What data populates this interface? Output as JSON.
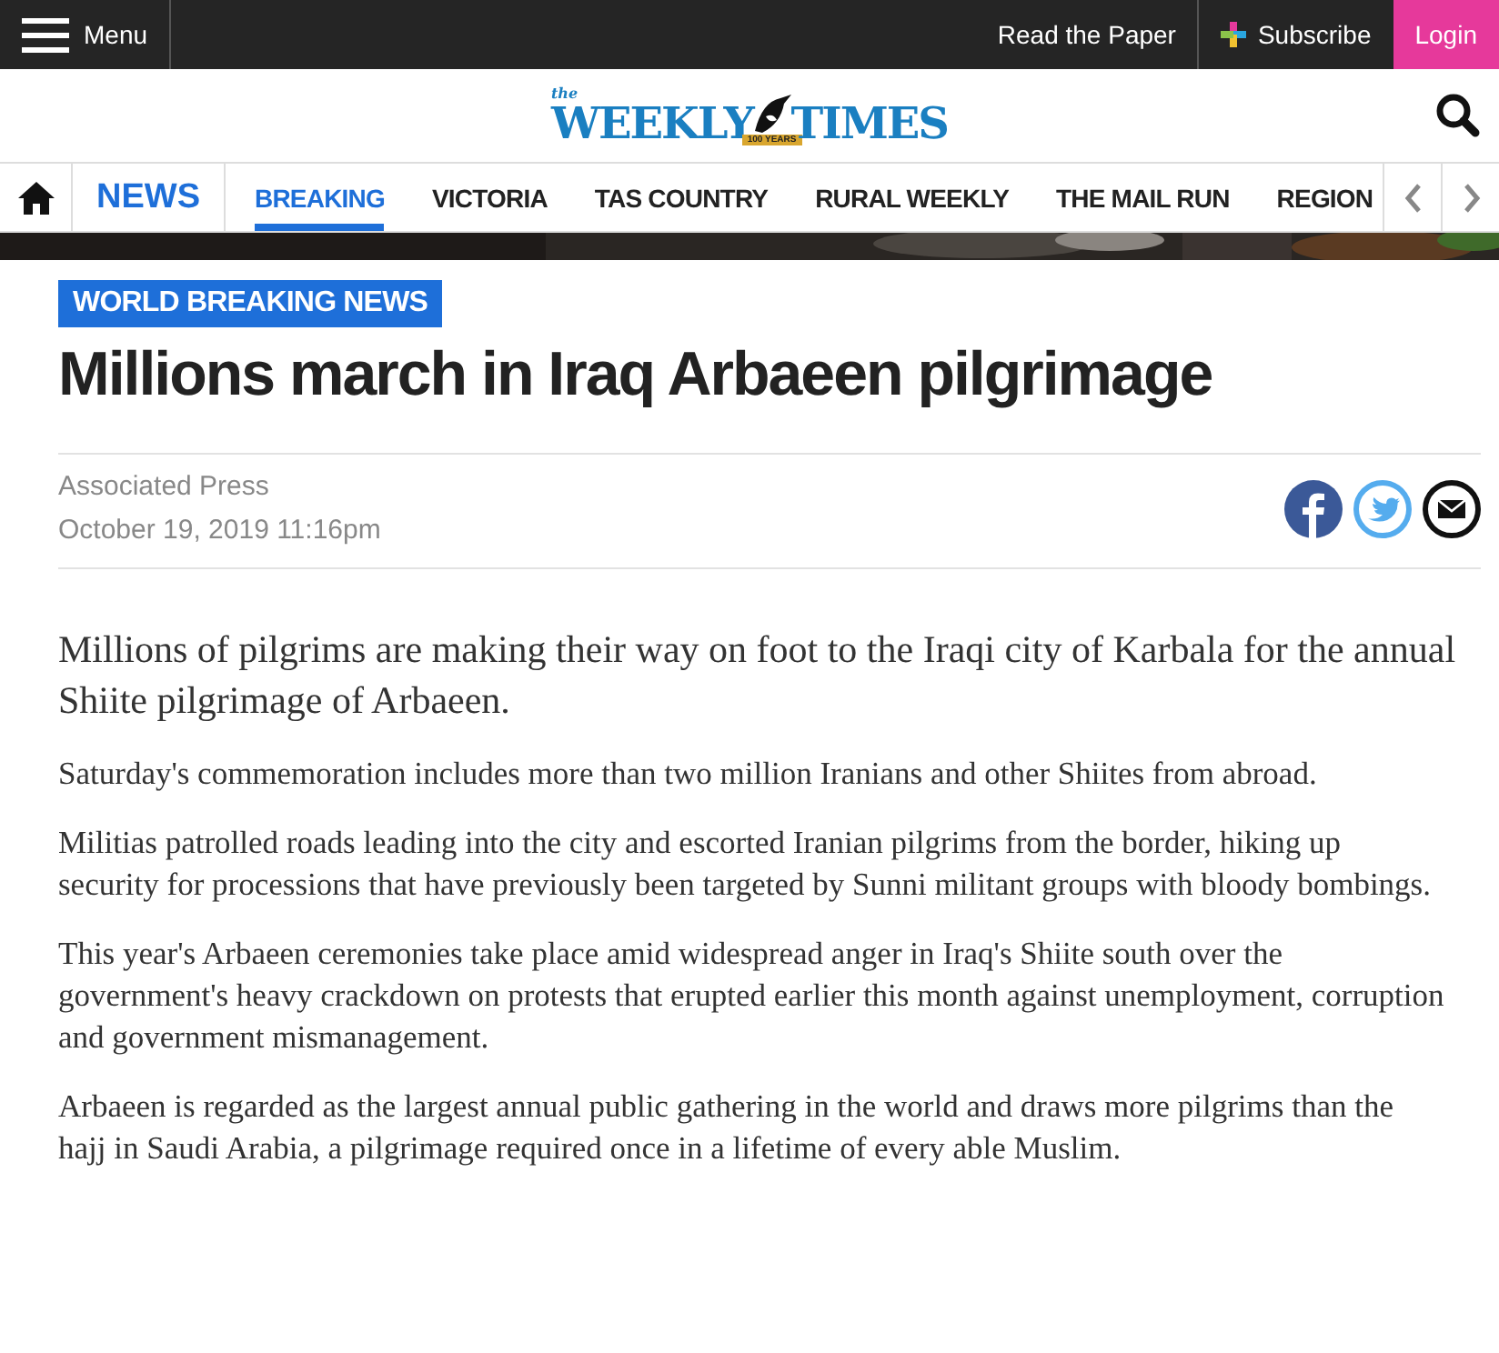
{
  "top_bar": {
    "menu": "Menu",
    "read_paper": "Read the Paper",
    "subscribe": "Subscribe",
    "login": "Login"
  },
  "logo": {
    "small": "the",
    "left": "WEEKLY",
    "right": "TIMES",
    "badge": "100 YEARS"
  },
  "nav": {
    "section": "NEWS",
    "items": [
      {
        "label": "BREAKING",
        "selected": true
      },
      {
        "label": "VICTORIA",
        "selected": false
      },
      {
        "label": "TAS COUNTRY",
        "selected": false
      },
      {
        "label": "RURAL WEEKLY",
        "selected": false
      },
      {
        "label": "THE MAIL RUN",
        "selected": false
      },
      {
        "label": "REGION",
        "selected": false
      }
    ]
  },
  "article": {
    "category": "WORLD BREAKING NEWS",
    "headline": "Millions march in Iraq Arbaeen pilgrimage",
    "author": "Associated Press",
    "date": "October 19, 2019 11:16pm",
    "lead": "Millions of pilgrims are making their way on foot to the Iraqi city of Karbala for the annual Shiite pilgrimage of Arbaeen.",
    "paragraphs": [
      "Saturday's commemoration includes more than two million Iranians and other Shiites from abroad.",
      "Militias patrolled roads leading into the city and escorted Iranian pilgrims from the border, hiking up security for processions that have previously been targeted by Sunni militant groups with bloody bombings.",
      "This year's Arbaeen ceremonies take place amid widespread anger in Iraq's Shiite south over the government's heavy crackdown on protests that erupted earlier this month against unemployment, corruption and government mismanagement.",
      "Arbaeen is regarded as the largest annual public gathering in the world and draws more pilgrims than the hajj in Saudi Arabia, a pilgrimage required once in a lifetime of every able Muslim."
    ]
  }
}
